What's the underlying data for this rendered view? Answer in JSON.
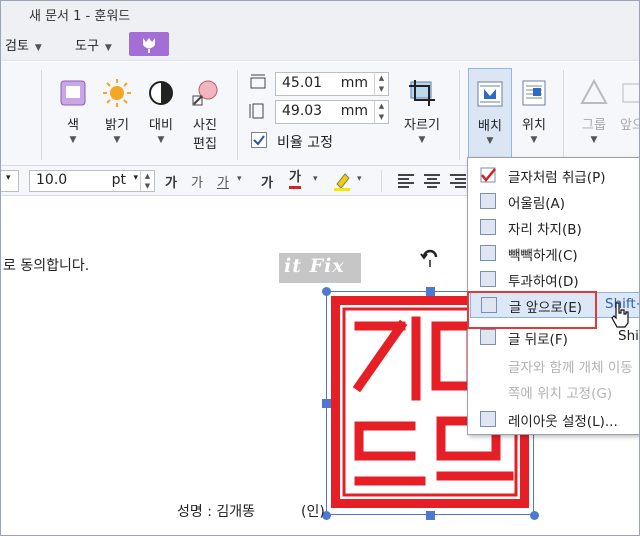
{
  "window": {
    "title": "새 문서 1 - 훈워드"
  },
  "menus": [
    {
      "label": "검토"
    },
    {
      "label": "도구"
    }
  ],
  "ribbon": {
    "color_label": "색",
    "brightness_label": "밝기",
    "contrast_label": "대비",
    "photo_edit_label1": "사진",
    "photo_edit_label2": "편집",
    "width_value": "45.01",
    "width_unit": "mm",
    "height_value": "49.03",
    "height_unit": "mm",
    "aspect_lock_label": "비율 고정",
    "crop_label": "자르기",
    "arrange_label": "배치",
    "position_label": "위치",
    "group_label": "그룹",
    "front_label": "앞으"
  },
  "format": {
    "font_size_value": "10.0",
    "font_size_unit": "pt",
    "glyph_a1": "가",
    "glyph_a2": "가",
    "glyph_a3": "가",
    "glyph_a4": "가",
    "glyph_a5": "가"
  },
  "document": {
    "agree_text": "로 동의합니다.",
    "watermark": "it Fix",
    "signature_text": "성명 : 김개똥",
    "seal_mark": "(인)"
  },
  "dropdown": {
    "items": [
      {
        "label": "글자처럼 취급(P)"
      },
      {
        "label": "어울림(A)"
      },
      {
        "label": "자리 차지(B)"
      },
      {
        "label": "빽빽하게(C)"
      },
      {
        "label": "투과하여(D)"
      },
      {
        "label": "글 앞으로(E)",
        "shortcut": "Shift+"
      },
      {
        "label": "글 뒤로(F)",
        "shortcut": "Shi"
      },
      {
        "label": "글자와 함께 개체 이동"
      },
      {
        "label": "쪽에 위치 고정(G)"
      },
      {
        "label": "레이아웃 설정(L)..."
      }
    ]
  },
  "colors": {
    "accent": "#a36fd6",
    "seal_red": "#e61f26",
    "highlight": "#e03a3a",
    "selection": "#4f78d1"
  }
}
